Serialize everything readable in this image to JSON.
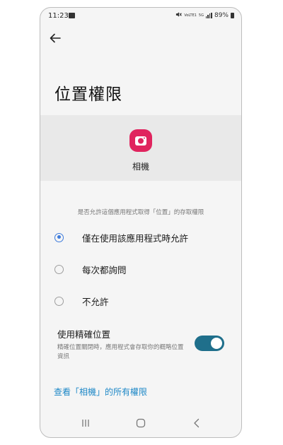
{
  "status_bar": {
    "time": "11:23",
    "volte_label": "VoLTE1",
    "network_label": "5G",
    "battery": "89%"
  },
  "page": {
    "title": "位置權限"
  },
  "app": {
    "name": "相機",
    "icon_color": "#e0245e"
  },
  "permission": {
    "question": "是否允許這個應用程式取得「位置」的存取權限",
    "options": [
      {
        "label": "僅在使用該應用程式時允許",
        "selected": true
      },
      {
        "label": "每次都詢問",
        "selected": false
      },
      {
        "label": "不允許",
        "selected": false
      }
    ]
  },
  "precise_location": {
    "title": "使用精確位置",
    "description": "精確位置關閉時，應用程式會存取你的概略位置資訊",
    "enabled": true
  },
  "link": {
    "all_permissions": "查看「相機」的所有權限"
  },
  "colors": {
    "accent": "#3d7bdb",
    "toggle_on": "#1f6f8b",
    "link": "#1e88c7"
  },
  "navigation_bar": {
    "icons": [
      "recent-apps-icon",
      "home-icon",
      "back-icon"
    ]
  }
}
